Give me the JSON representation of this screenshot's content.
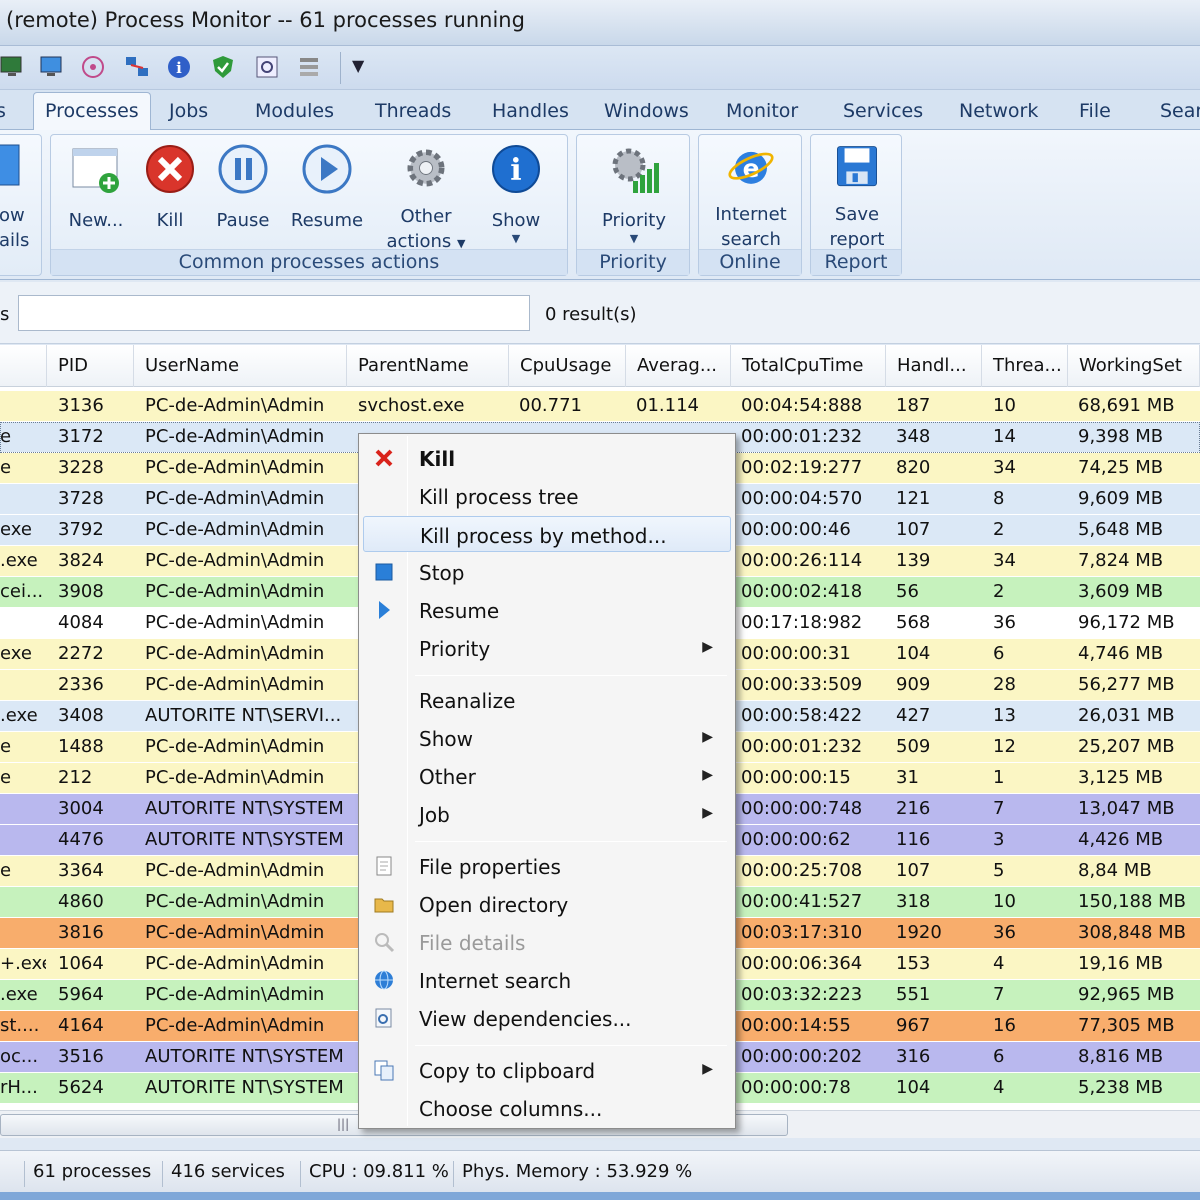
{
  "window": {
    "title": "(remote) Process Monitor -- 61 processes running"
  },
  "quick_access": {
    "icons": [
      "monitor-icon",
      "computer-icon",
      "target-icon",
      "network-icon",
      "info-icon",
      "shield-icon",
      "settings-icon",
      "tools-icon"
    ],
    "dropdown": "▼"
  },
  "tabs": [
    "Processes",
    "Jobs",
    "Modules",
    "Threads",
    "Handles",
    "Windows",
    "Monitor",
    "Services",
    "Network",
    "File",
    "Sear"
  ],
  "ribbon": {
    "left_partial": {
      "line1": "ow",
      "line2": "ails"
    },
    "common": {
      "label": "Common processes actions",
      "buttons": {
        "new": "New...",
        "kill": "Kill",
        "pause": "Pause",
        "resume": "Resume",
        "other1": "Other",
        "other2": "actions",
        "show": "Show"
      }
    },
    "priority": {
      "label": "Priority",
      "button": "Priority"
    },
    "online": {
      "label": "Online",
      "line1": "Internet",
      "line2": "search"
    },
    "report": {
      "label": "Report",
      "line1": "Save",
      "line2": "report"
    }
  },
  "search": {
    "label": "s",
    "value": "",
    "results": "0 result(s)"
  },
  "columns": [
    "PID",
    "UserName",
    "ParentName",
    "CpuUsage",
    "Averag...",
    "TotalCpuTime",
    "Handl...",
    "Threa...",
    "WorkingSet"
  ],
  "rows": [
    {
      "name": "",
      "pid": "3136",
      "user": "PC-de-Admin\\Admin",
      "parent": "svchost.exe",
      "cpu": "00.771",
      "avg": "01.114",
      "time": "00:04:54:888",
      "handles": "187",
      "threads": "10",
      "ws": "68,691 MB",
      "color": "yellow"
    },
    {
      "name": "e",
      "pid": "3172",
      "user": "PC-de-Admin\\Admin",
      "parent": "",
      "cpu": "",
      "avg": "",
      "time": "00:00:01:232",
      "handles": "348",
      "threads": "14",
      "ws": "9,398 MB",
      "color": "blue"
    },
    {
      "name": "e",
      "pid": "3228",
      "user": "PC-de-Admin\\Admin",
      "parent": "",
      "cpu": "",
      "avg": "",
      "time": "00:02:19:277",
      "handles": "820",
      "threads": "34",
      "ws": "74,25 MB",
      "color": "yellow"
    },
    {
      "name": "",
      "pid": "3728",
      "user": "PC-de-Admin\\Admin",
      "parent": "",
      "cpu": "",
      "avg": "",
      "time": "00:00:04:570",
      "handles": "121",
      "threads": "8",
      "ws": "9,609 MB",
      "color": "blue"
    },
    {
      "name": "exe",
      "pid": "3792",
      "user": "PC-de-Admin\\Admin",
      "parent": "",
      "cpu": "",
      "avg": "",
      "time": "00:00:00:46",
      "handles": "107",
      "threads": "2",
      "ws": "5,648 MB",
      "color": "blue"
    },
    {
      "name": ".exe",
      "pid": "3824",
      "user": "PC-de-Admin\\Admin",
      "parent": "",
      "cpu": "",
      "avg": "",
      "time": "00:00:26:114",
      "handles": "139",
      "threads": "34",
      "ws": "7,824 MB",
      "color": "yellow"
    },
    {
      "name": "cei...",
      "pid": "3908",
      "user": "PC-de-Admin\\Admin",
      "parent": "",
      "cpu": "",
      "avg": "",
      "time": "00:00:02:418",
      "handles": "56",
      "threads": "2",
      "ws": "3,609 MB",
      "color": "green"
    },
    {
      "name": "",
      "pid": "4084",
      "user": "PC-de-Admin\\Admin",
      "parent": "",
      "cpu": "",
      "avg": "",
      "time": "00:17:18:982",
      "handles": "568",
      "threads": "36",
      "ws": "96,172 MB",
      "color": "white"
    },
    {
      "name": "exe",
      "pid": "2272",
      "user": "PC-de-Admin\\Admin",
      "parent": "",
      "cpu": "",
      "avg": "",
      "time": "00:00:00:31",
      "handles": "104",
      "threads": "6",
      "ws": "4,746 MB",
      "color": "yellow"
    },
    {
      "name": "",
      "pid": "2336",
      "user": "PC-de-Admin\\Admin",
      "parent": "",
      "cpu": "",
      "avg": "",
      "time": "00:00:33:509",
      "handles": "909",
      "threads": "28",
      "ws": "56,277 MB",
      "color": "yellow"
    },
    {
      "name": ".exe",
      "pid": "3408",
      "user": "AUTORITE NT\\SERVI...",
      "parent": "",
      "cpu": "",
      "avg": "",
      "time": "00:00:58:422",
      "handles": "427",
      "threads": "13",
      "ws": "26,031 MB",
      "color": "blue"
    },
    {
      "name": "e",
      "pid": "1488",
      "user": "PC-de-Admin\\Admin",
      "parent": "",
      "cpu": "",
      "avg": "",
      "time": "00:00:01:232",
      "handles": "509",
      "threads": "12",
      "ws": "25,207 MB",
      "color": "yellow"
    },
    {
      "name": "e",
      "pid": "212",
      "user": "PC-de-Admin\\Admin",
      "parent": "",
      "cpu": "",
      "avg": "",
      "time": "00:00:00:15",
      "handles": "31",
      "threads": "1",
      "ws": "3,125 MB",
      "color": "yellow"
    },
    {
      "name": "",
      "pid": "3004",
      "user": "AUTORITE NT\\SYSTEM",
      "parent": "",
      "cpu": "",
      "avg": "",
      "time": "00:00:00:748",
      "handles": "216",
      "threads": "7",
      "ws": "13,047 MB",
      "color": "purple"
    },
    {
      "name": "",
      "pid": "4476",
      "user": "AUTORITE NT\\SYSTEM",
      "parent": "",
      "cpu": "",
      "avg": "",
      "time": "00:00:00:62",
      "handles": "116",
      "threads": "3",
      "ws": "4,426 MB",
      "color": "purple"
    },
    {
      "name": "e",
      "pid": "3364",
      "user": "PC-de-Admin\\Admin",
      "parent": "",
      "cpu": "",
      "avg": "",
      "time": "00:00:25:708",
      "handles": "107",
      "threads": "5",
      "ws": "8,84 MB",
      "color": "yellow"
    },
    {
      "name": "",
      "pid": "4860",
      "user": "PC-de-Admin\\Admin",
      "parent": "",
      "cpu": "",
      "avg": "",
      "time": "00:00:41:527",
      "handles": "318",
      "threads": "10",
      "ws": "150,188 MB",
      "color": "green"
    },
    {
      "name": "",
      "pid": "3816",
      "user": "PC-de-Admin\\Admin",
      "parent": "",
      "cpu": "",
      "avg": "",
      "time": "00:03:17:310",
      "handles": "1920",
      "threads": "36",
      "ws": "308,848 MB",
      "color": "orange"
    },
    {
      "name": "+.exe",
      "pid": "1064",
      "user": "PC-de-Admin\\Admin",
      "parent": "",
      "cpu": "",
      "avg": "",
      "time": "00:00:06:364",
      "handles": "153",
      "threads": "4",
      "ws": "19,16 MB",
      "color": "yellow"
    },
    {
      "name": ".exe",
      "pid": "5964",
      "user": "PC-de-Admin\\Admin",
      "parent": "",
      "cpu": "",
      "avg": "",
      "time": "00:03:32:223",
      "handles": "551",
      "threads": "7",
      "ws": "92,965 MB",
      "color": "green"
    },
    {
      "name": "st....",
      "pid": "4164",
      "user": "PC-de-Admin\\Admin",
      "parent": "",
      "cpu": "",
      "avg": "",
      "time": "00:00:14:55",
      "handles": "967",
      "threads": "16",
      "ws": "77,305 MB",
      "color": "orange"
    },
    {
      "name": "oc...",
      "pid": "3516",
      "user": "AUTORITE NT\\SYSTEM",
      "parent": "",
      "cpu": "",
      "avg": "",
      "time": "00:00:00:202",
      "handles": "316",
      "threads": "6",
      "ws": "8,816 MB",
      "color": "purple"
    },
    {
      "name": "rH...",
      "pid": "5624",
      "user": "AUTORITE NT\\SYSTEM",
      "parent": "",
      "cpu": "",
      "avg": "",
      "time": "00:00:00:78",
      "handles": "104",
      "threads": "4",
      "ws": "5,238 MB",
      "color": "green"
    }
  ],
  "context_menu": {
    "items": [
      {
        "label": "Kill",
        "icon": "close-icon",
        "bold": true
      },
      {
        "label": "Kill process tree"
      },
      {
        "label": "Kill process by method...",
        "highlighted": true
      },
      {
        "label": "Stop",
        "icon": "stop-icon"
      },
      {
        "label": "Resume",
        "icon": "play-icon"
      },
      {
        "label": "Priority",
        "submenu": true
      },
      {
        "separator": true
      },
      {
        "label": "Reanalize"
      },
      {
        "label": "Show",
        "submenu": true
      },
      {
        "label": "Other",
        "submenu": true
      },
      {
        "label": "Job",
        "submenu": true
      },
      {
        "separator": true
      },
      {
        "label": "File properties",
        "icon": "document-icon"
      },
      {
        "label": "Open directory",
        "icon": "folder-icon"
      },
      {
        "label": "File details",
        "icon": "magnifier-icon",
        "disabled": true
      },
      {
        "label": "Internet search",
        "icon": "globe-icon"
      },
      {
        "label": "View dependencies...",
        "icon": "dependencies-icon"
      },
      {
        "separator": true
      },
      {
        "label": "Copy to clipboard",
        "icon": "copy-icon",
        "submenu": true
      },
      {
        "label": "Choose columns..."
      }
    ],
    "submenu_arrow": "▶"
  },
  "status": {
    "processes": "61 processes",
    "services": "416 services",
    "cpu": "CPU : 09.811 %",
    "memory": "Phys. Memory : 53.929 %"
  },
  "colors": {
    "yellow": "#fbf6c4",
    "blue": "#dbe8f6",
    "green": "#c6f2bd",
    "purple": "#b9b8ee",
    "orange": "#f8ad6c",
    "white": "#ffffff"
  }
}
